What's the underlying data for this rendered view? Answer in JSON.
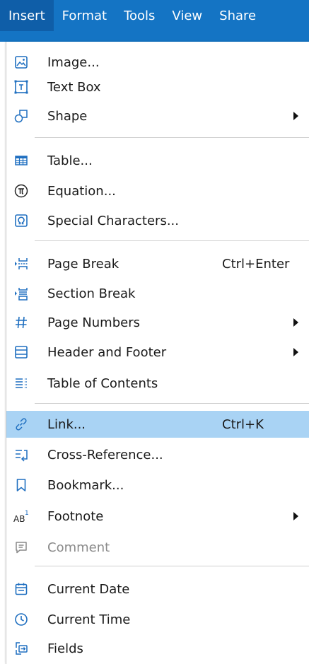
{
  "menubar": {
    "items": [
      "Insert",
      "Format",
      "Tools",
      "View",
      "Share"
    ],
    "active": "Insert"
  },
  "menu": {
    "items": [
      {
        "label": "Image...",
        "icon": "image-icon"
      },
      {
        "label": "Text Box",
        "icon": "text-box-icon"
      },
      {
        "label": "Shape",
        "icon": "shape-icon",
        "submenu": true
      },
      {
        "label": "Table...",
        "icon": "table-icon"
      },
      {
        "label": "Equation...",
        "icon": "equation-icon"
      },
      {
        "label": "Special Characters...",
        "icon": "special-characters-icon"
      },
      {
        "label": "Page Break",
        "icon": "page-break-icon",
        "shortcut": "Ctrl+Enter"
      },
      {
        "label": "Section Break",
        "icon": "section-break-icon"
      },
      {
        "label": "Page Numbers",
        "icon": "page-numbers-icon",
        "submenu": true
      },
      {
        "label": "Header and Footer",
        "icon": "header-footer-icon",
        "submenu": true
      },
      {
        "label": "Table of Contents",
        "icon": "table-of-contents-icon"
      },
      {
        "label": "Link...",
        "icon": "link-icon",
        "shortcut": "Ctrl+K",
        "highlighted": true
      },
      {
        "label": "Cross-Reference...",
        "icon": "cross-reference-icon"
      },
      {
        "label": "Bookmark...",
        "icon": "bookmark-icon"
      },
      {
        "label": "Footnote",
        "icon": "footnote-icon",
        "submenu": true
      },
      {
        "label": "Comment",
        "icon": "comment-icon",
        "disabled": true
      },
      {
        "label": "Current Date",
        "icon": "calendar-icon"
      },
      {
        "label": "Current Time",
        "icon": "clock-icon"
      },
      {
        "label": "Fields",
        "icon": "fields-icon"
      }
    ]
  },
  "colors": {
    "menubar_bg": "#1474c4",
    "active_menu_bg": "#0f5ea8",
    "highlight_bg": "#a9d3f4",
    "icon_blue": "#1f6fc0"
  }
}
